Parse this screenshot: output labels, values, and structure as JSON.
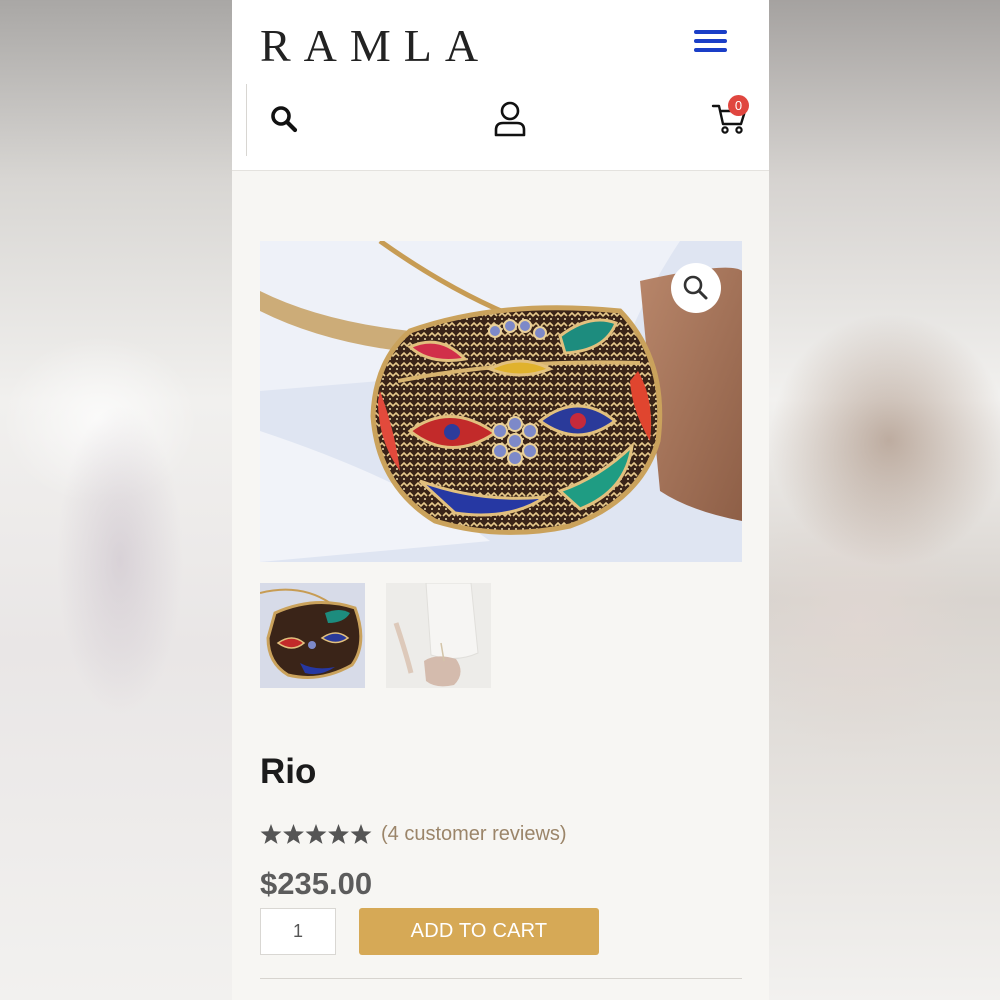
{
  "brand": {
    "logo_text": "RAMLA",
    "accent_color": "#1a3ec7"
  },
  "header": {
    "icons": [
      "menu-icon",
      "search-icon",
      "account-icon",
      "cart-icon"
    ],
    "cart_count": "0",
    "cart_badge_color": "#e0463f"
  },
  "gallery": {
    "thumbnails": 2,
    "zoom_icon": "magnifier-icon"
  },
  "product": {
    "name": "Rio",
    "rating": 5,
    "rating_max": 5,
    "reviews_text": "(4 customer reviews)",
    "price": "$235.00",
    "quantity": "1",
    "add_to_cart_label": "ADD TO CART",
    "button_color": "#d6a956"
  }
}
